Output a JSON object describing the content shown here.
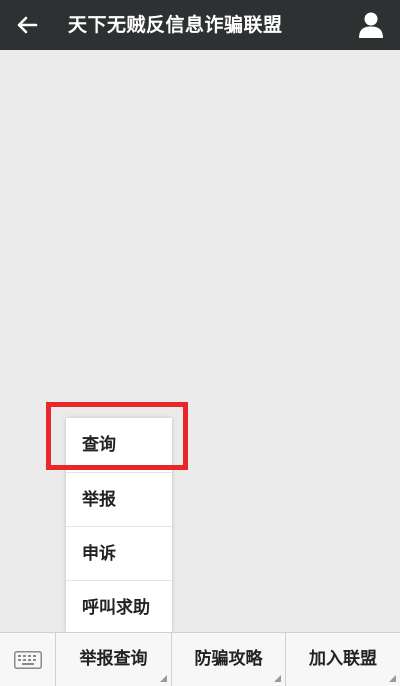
{
  "header": {
    "title": "天下无贼反信息诈骗联盟",
    "back_icon": "back-arrow-icon",
    "profile_icon": "person-icon"
  },
  "popup_menu": {
    "items": [
      {
        "label": "查询"
      },
      {
        "label": "举报"
      },
      {
        "label": "申诉"
      },
      {
        "label": "呼叫求助"
      }
    ]
  },
  "bottom_menu": {
    "keyboard_icon": "keyboard-icon",
    "tabs": [
      {
        "label": "举报查询"
      },
      {
        "label": "防骗攻略"
      },
      {
        "label": "加入联盟"
      }
    ]
  },
  "colors": {
    "header_bg": "#2e3132",
    "highlight": "#e8272b",
    "content_bg": "#ebebeb"
  }
}
